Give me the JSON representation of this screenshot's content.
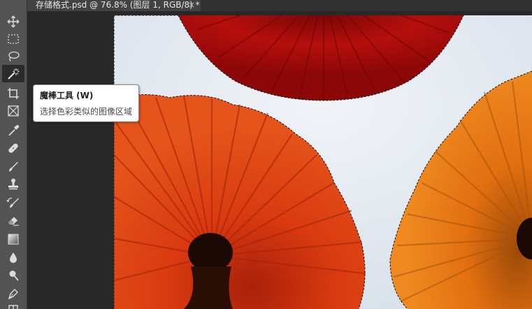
{
  "document": {
    "tab_title": "存储格式.psd @ 76.8% (图层 1, RGB/8) *",
    "close_symbol": "×"
  },
  "toolbar": {
    "tools": [
      {
        "name": "move-tool",
        "icon": "move-icon",
        "active": false
      },
      {
        "name": "marquee-tool",
        "icon": "rect-marquee-icon",
        "active": false
      },
      {
        "name": "lasso-tool",
        "icon": "lasso-icon",
        "active": false
      },
      {
        "name": "magic-wand-tool",
        "icon": "magic-wand-icon",
        "active": true
      },
      {
        "name": "crop-tool",
        "icon": "crop-icon",
        "active": false
      },
      {
        "name": "frame-tool",
        "icon": "frame-icon",
        "active": false
      },
      {
        "name": "eyedropper-tool",
        "icon": "eyedropper-icon",
        "active": false
      },
      {
        "name": "healing-brush-tool",
        "icon": "bandage-icon",
        "active": false
      },
      {
        "name": "brush-tool",
        "icon": "brush-icon",
        "active": false
      },
      {
        "name": "clone-stamp-tool",
        "icon": "stamp-icon",
        "active": false
      },
      {
        "name": "history-brush-tool",
        "icon": "history-brush-icon",
        "active": false
      },
      {
        "name": "eraser-tool",
        "icon": "eraser-icon",
        "active": false
      },
      {
        "name": "gradient-tool",
        "icon": "gradient-icon",
        "active": false
      },
      {
        "name": "blur-tool",
        "icon": "drop-icon",
        "active": false
      },
      {
        "name": "dodge-tool",
        "icon": "dodge-icon",
        "active": false
      },
      {
        "name": "pen-tool",
        "icon": "pen-icon",
        "active": false
      },
      {
        "name": "type-tool",
        "icon": "type-icon",
        "active": false
      }
    ]
  },
  "tooltip": {
    "title": "魔棒工具 (W)",
    "description": "选择色彩类似的图像区域"
  },
  "colors": {
    "toolbar_bg": "#535353",
    "canvas_bg": "#282828",
    "sky": "#dfe7ef",
    "umbrella_top": "#b5100c",
    "umbrella_left": "#d8380e",
    "umbrella_right": "#e06a0e"
  }
}
